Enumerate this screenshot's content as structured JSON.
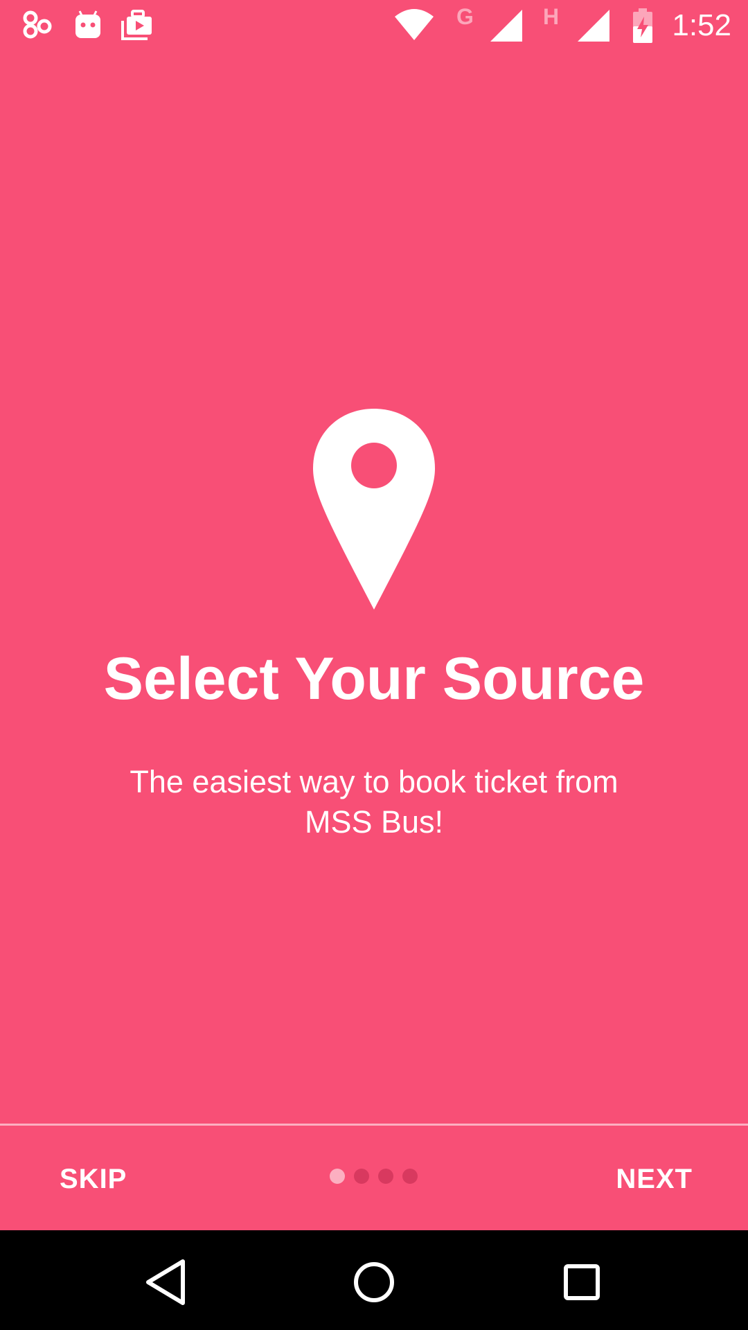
{
  "status_bar": {
    "time": "1:52",
    "left_icons": [
      "connection-hub-icon",
      "android-robot-icon",
      "media-briefcase-icon"
    ],
    "right_icons": [
      "wifi-icon",
      "network-g-icon",
      "signal-icon",
      "network-h-icon",
      "signal-icon",
      "battery-charging-icon"
    ],
    "network_label_1": "G",
    "network_label_2": "H"
  },
  "onboarding": {
    "icon": "location-pin-icon",
    "title": "Select Your Source",
    "description": "The easiest way to book ticket from MSS Bus!",
    "page_count": 4,
    "current_page": 1
  },
  "footer": {
    "skip_label": "SKIP",
    "next_label": "NEXT"
  },
  "nav_bar": {
    "buttons": [
      "back-icon",
      "home-icon",
      "recents-icon"
    ]
  },
  "colors": {
    "background": "#F84F76",
    "text": "#FFFFFF",
    "dot_active": "#FCA6BA",
    "dot_inactive": "#D8395F",
    "nav_bar": "#000000"
  }
}
